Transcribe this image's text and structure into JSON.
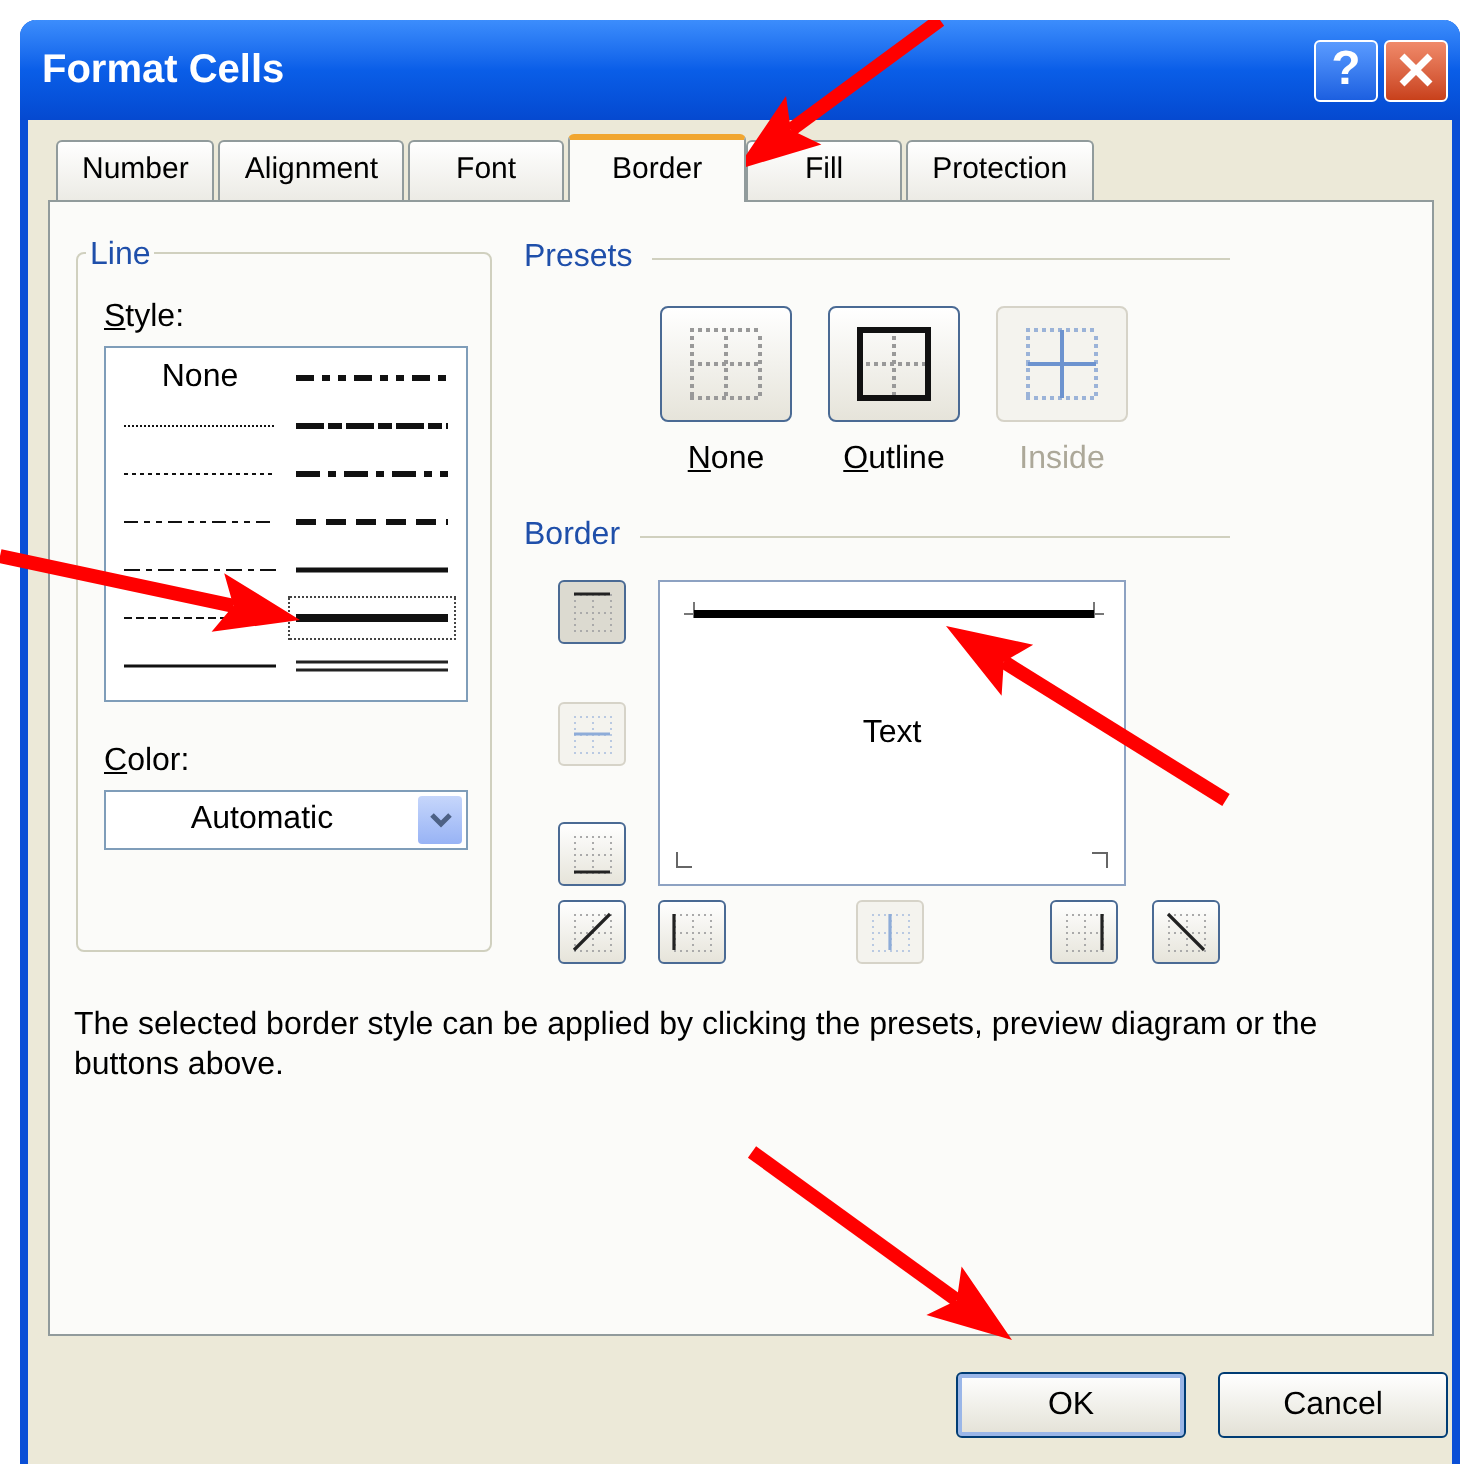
{
  "window": {
    "title": "Format Cells",
    "help_glyph": "?"
  },
  "tabs": [
    {
      "label": "Number",
      "selected": false
    },
    {
      "label": "Alignment",
      "selected": false
    },
    {
      "label": "Font",
      "selected": false
    },
    {
      "label": "Border",
      "selected": true
    },
    {
      "label": "Fill",
      "selected": false
    },
    {
      "label": "Protection",
      "selected": false
    }
  ],
  "line_group": {
    "title": "Line",
    "style_label": {
      "text": "Style:",
      "mnemonic_underlined": true
    },
    "color_label": {
      "text": "Color:",
      "mnemonic_underlined": true
    },
    "color_value": "Automatic"
  },
  "line_styles": [
    {
      "kind": "none",
      "label": "None",
      "selected": false
    },
    {
      "kind": "hair",
      "selected": false
    },
    {
      "kind": "dotted",
      "selected": false
    },
    {
      "kind": "dash_dot_dot",
      "selected": false
    },
    {
      "kind": "dash_dot",
      "selected": false
    },
    {
      "kind": "dashed",
      "selected": false
    },
    {
      "kind": "thin",
      "selected": false
    },
    {
      "kind": "medium_dash_dot_dot",
      "selected": false
    },
    {
      "kind": "slanted_dash_dot",
      "selected": false
    },
    {
      "kind": "medium_dash_dot",
      "selected": false
    },
    {
      "kind": "medium_dashed",
      "selected": false
    },
    {
      "kind": "medium",
      "selected": false
    },
    {
      "kind": "thick",
      "selected": true
    },
    {
      "kind": "double",
      "selected": false
    }
  ],
  "presets": {
    "title": "Presets",
    "items": [
      {
        "kind": "none",
        "label": "None",
        "mnemonic_underlined": true,
        "disabled": false
      },
      {
        "kind": "outline",
        "label": "Outline",
        "mnemonic_underlined": true,
        "disabled": false
      },
      {
        "kind": "inside",
        "label": "Inside",
        "mnemonic_underlined": false,
        "disabled": true
      }
    ]
  },
  "border": {
    "title": "Border",
    "preview_text": "Text",
    "buttons": [
      {
        "kind": "top",
        "pressed": true,
        "disabled": false
      },
      {
        "kind": "middle_horizontal",
        "pressed": false,
        "disabled": true
      },
      {
        "kind": "bottom",
        "pressed": false,
        "disabled": false
      },
      {
        "kind": "diagonal_up",
        "pressed": false,
        "disabled": false
      },
      {
        "kind": "left",
        "pressed": false,
        "disabled": false
      },
      {
        "kind": "middle_vertical",
        "pressed": false,
        "disabled": true
      },
      {
        "kind": "right",
        "pressed": false,
        "disabled": false
      },
      {
        "kind": "diagonal_down",
        "pressed": false,
        "disabled": false
      }
    ]
  },
  "description": "The selected border style can be applied by clicking the presets, preview diagram or the buttons above.",
  "buttons": [
    {
      "label": "OK",
      "default": true
    },
    {
      "label": "Cancel",
      "default": false
    }
  ],
  "annotations": [
    {
      "kind": "arrow",
      "color": "#ff0000"
    },
    {
      "kind": "arrow",
      "color": "#ff0000"
    },
    {
      "kind": "arrow",
      "color": "#ff0000"
    },
    {
      "kind": "arrow",
      "color": "#ff0000"
    }
  ]
}
